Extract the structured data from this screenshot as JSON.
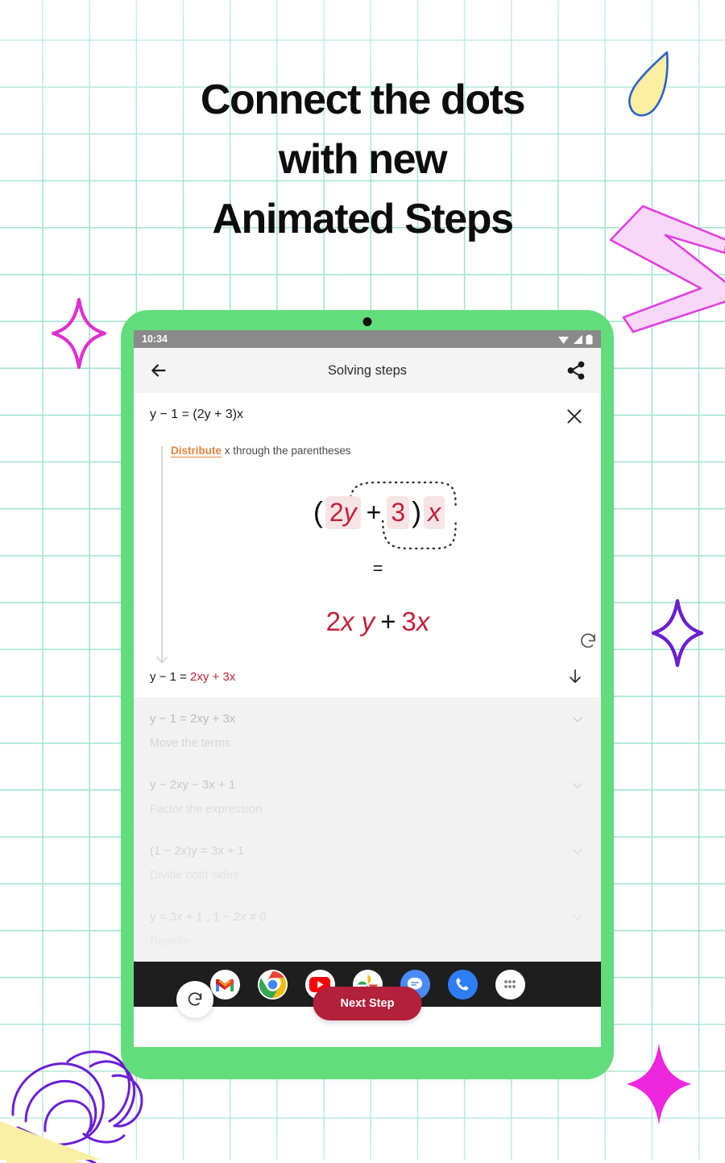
{
  "headline": {
    "lines": [
      "Connect the dots",
      "with new",
      "Animated Steps"
    ]
  },
  "colors": {
    "bezel": "#62dd7c",
    "grid": "#9fe5c6",
    "accent_red": "#c32038",
    "button_red": "#b3203a",
    "keyword_orange": "#e8823c"
  },
  "device": {
    "status_bar": {
      "time": "10:34",
      "icons": [
        "wifi-icon",
        "signal-icon",
        "battery-icon"
      ]
    },
    "app_bar": {
      "title": "Solving steps",
      "back_icon": "back-arrow-icon",
      "share_icon": "share-icon"
    },
    "active_step": {
      "equation": "y − 1 = (2y + 3)x",
      "close_icon": "close-icon",
      "hint_keyword": "Distribute",
      "hint_rest": " x through the parentheses",
      "expression": {
        "open_paren": "(",
        "term_a": "2",
        "term_a_var": "y",
        "operator": "+",
        "term_b": "3",
        "close_paren": ")",
        "multiplier": "x"
      },
      "equals_sign": "=",
      "result": {
        "left_coef": "2",
        "left_vars": "x y",
        "operator": "+",
        "right_coef": "3",
        "right_var": "x"
      },
      "replay_icon": "replay-icon",
      "footer_equation_left": "y − 1 = ",
      "footer_equation_right": "2xy + 3x",
      "down_icon": "down-arrow-icon"
    },
    "steps": [
      {
        "equation": "y − 1 = 2xy + 3x",
        "description": "Move the terms",
        "chevron_icon": "chevron-down-icon"
      },
      {
        "equation": "y − 2xy − 3x + 1",
        "description": "Factor the expression",
        "chevron_icon": "chevron-down-icon"
      },
      {
        "equation": "(1 − 2x)y = 3x + 1",
        "description": "Divide both sides",
        "chevron_icon": "chevron-down-icon"
      },
      {
        "equation": "y = 3x + 1 , 1 − 2x ≠ 0",
        "description": "Rewrite",
        "chevron_icon": "chevron-down-icon"
      }
    ],
    "next_step_button": "Next Step",
    "replay_fab_icon": "replay-icon",
    "dock": [
      {
        "name": "gmail-icon",
        "label": "Gmail"
      },
      {
        "name": "chrome-icon",
        "label": "Chrome"
      },
      {
        "name": "youtube-icon",
        "label": "YouTube"
      },
      {
        "name": "photos-icon",
        "label": "Photos"
      },
      {
        "name": "messages-icon",
        "label": "Messages"
      },
      {
        "name": "phone-icon",
        "label": "Phone"
      },
      {
        "name": "app-drawer-icon",
        "label": "All apps"
      }
    ]
  },
  "decorations": [
    {
      "name": "teardrop-shape",
      "color": "#fcf0a0"
    },
    {
      "name": "chevron-arrow-shape",
      "color": "#f7d6f7"
    },
    {
      "name": "sparkle-star-outline-magenta",
      "color": "#e030d0"
    },
    {
      "name": "sparkle-star-outline-purple",
      "color": "#6a1fd0"
    },
    {
      "name": "sparkle-star-solid-magenta",
      "color": "#ee26dd"
    },
    {
      "name": "scribble-loops",
      "color": "#6b1fd6"
    },
    {
      "name": "yellow-triangle",
      "color": "#fbefa4"
    }
  ]
}
